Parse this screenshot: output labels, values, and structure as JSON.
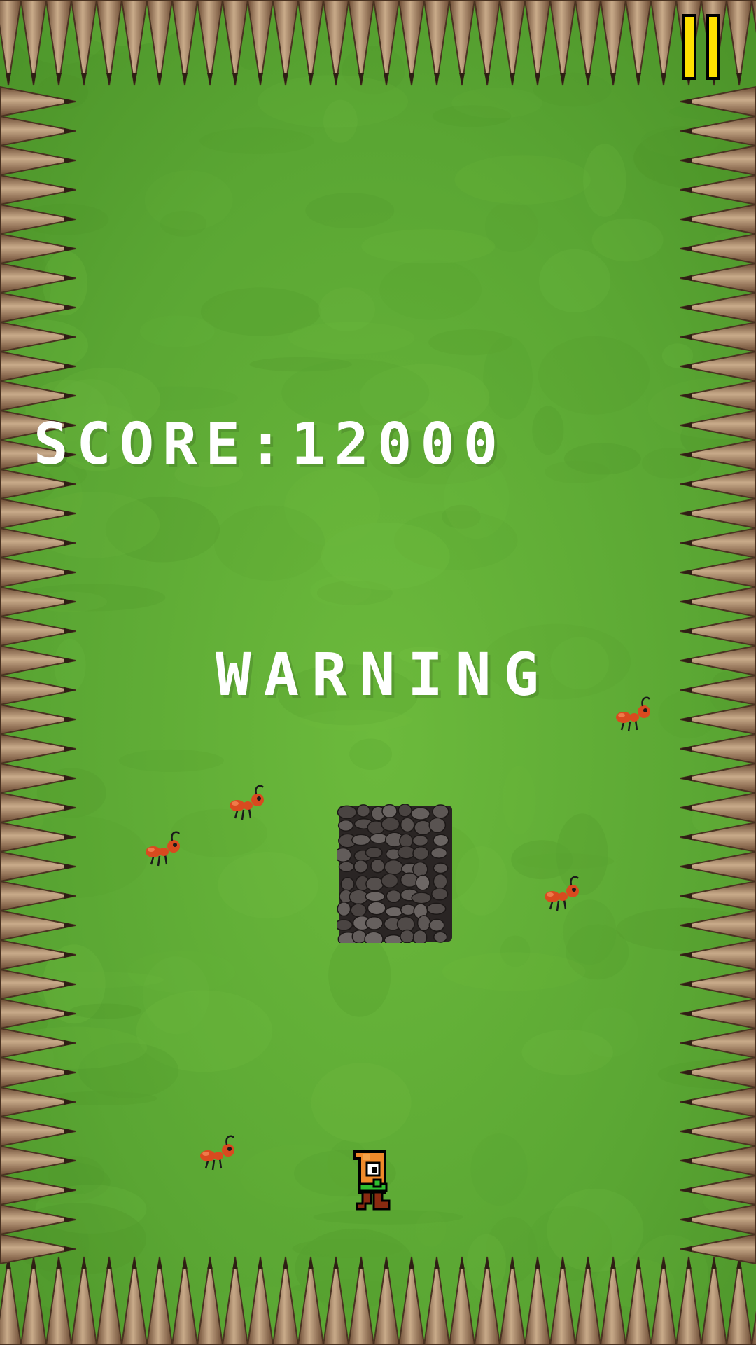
{
  "hud": {
    "score_label": "SCORE:",
    "score_value": "12000",
    "warning_text": "WARNING"
  },
  "pause_button": {
    "icon": "pause-icon",
    "color": "#ffe000"
  },
  "colors": {
    "grass": "#5aa633",
    "spike_wood": "#8a6a4a",
    "spike_tip": "#3a2a1e",
    "ant_red": "#d94a1f",
    "rock": "#3a3432"
  },
  "sprites": {
    "ants": [
      "ant",
      "ant",
      "ant",
      "ant",
      "ant"
    ],
    "rock": "rock-obstacle",
    "player": "player-character"
  }
}
